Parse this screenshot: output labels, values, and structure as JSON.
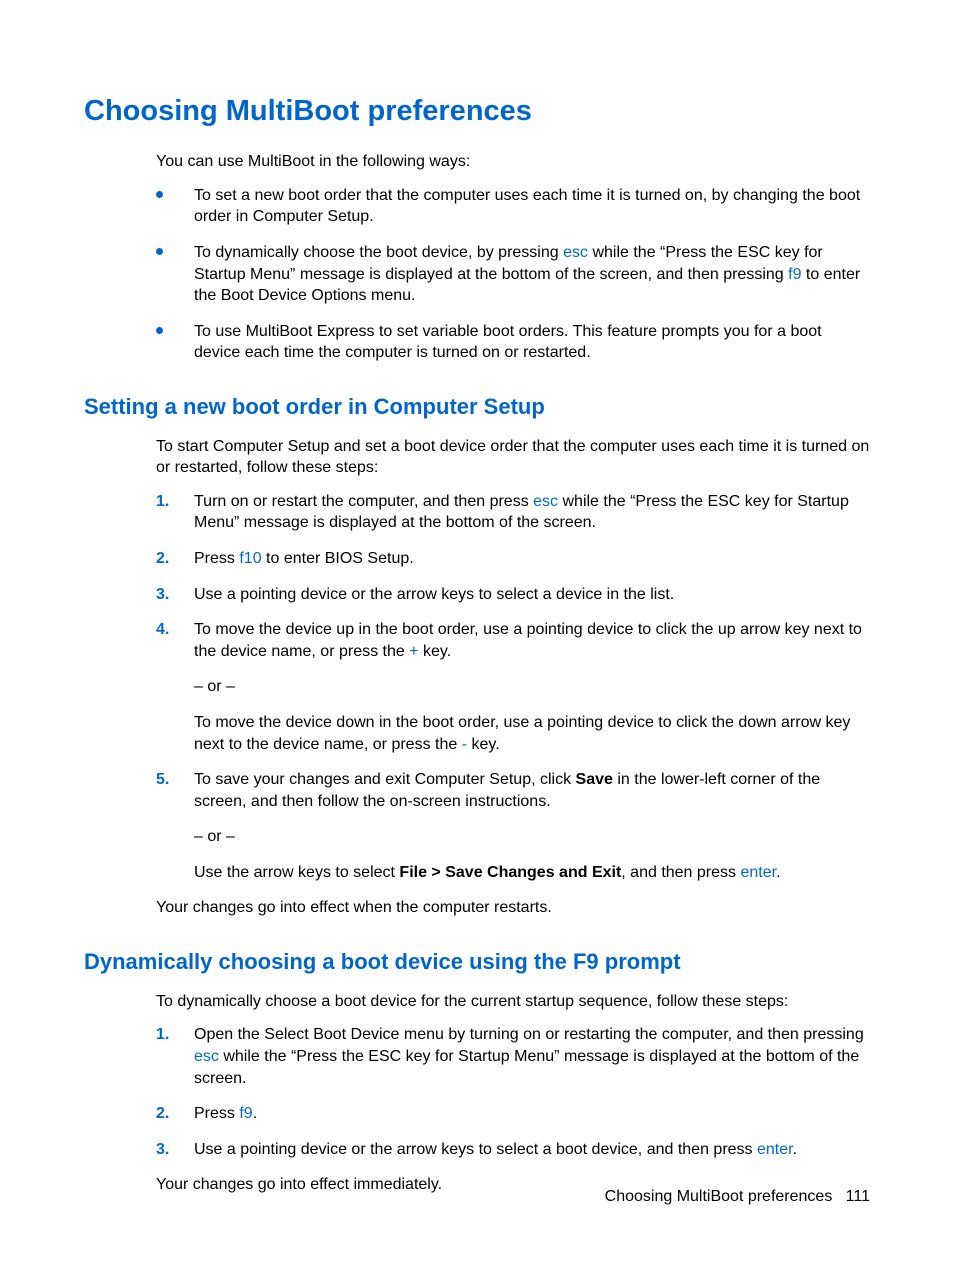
{
  "h1": "Choosing MultiBoot preferences",
  "intro1": "You can use MultiBoot in the following ways:",
  "bullets": {
    "b1": "To set a new boot order that the computer uses each time it is turned on, by changing the boot order in Computer Setup.",
    "b2a": "To dynamically choose the boot device, by pressing ",
    "b2_esc": "esc",
    "b2b": " while the “Press the ESC key for Startup Menu” message is displayed at the bottom of the screen, and then pressing ",
    "b2_f9": "f9",
    "b2c": " to enter the Boot Device Options menu.",
    "b3": "To use MultiBoot Express to set variable boot orders. This feature prompts you for a boot device each time the computer is turned on or restarted."
  },
  "h2a": "Setting a new boot order in Computer Setup",
  "p2": "To start Computer Setup and set a boot device order that the computer uses each time it is turned on or restarted, follow these steps:",
  "steps_a": {
    "s1a": "Turn on or restart the computer, and then press ",
    "s1_esc": "esc",
    "s1b": " while the “Press the ESC key for Startup Menu” message is displayed at the bottom of the screen.",
    "s2a": "Press ",
    "s2_f10": "f10",
    "s2b": " to enter BIOS Setup.",
    "s3": "Use a pointing device or the arrow keys to select a device in the list.",
    "s4a": "To move the device up in the boot order, use a pointing device to click the up arrow key next to the device name, or press the ",
    "s4_plus": "+",
    "s4b": " key.",
    "s4_or": "– or –",
    "s4c": "To move the device down in the boot order, use a pointing device to click the down arrow key next to the device name, or press the ",
    "s4_minus": "-",
    "s4d": " key.",
    "s5a": "To save your changes and exit Computer Setup, click ",
    "s5_save": "Save",
    "s5b": " in the lower-left corner of the screen, and then follow the on-screen instructions.",
    "s5_or": "– or –",
    "s5c": "Use the arrow keys to select ",
    "s5_path": "File > Save Changes and Exit",
    "s5d": ", and then press ",
    "s5_enter": "enter",
    "s5e": "."
  },
  "p3": "Your changes go into effect when the computer restarts.",
  "h2b": "Dynamically choosing a boot device using the F9 prompt",
  "p4": "To dynamically choose a boot device for the current startup sequence, follow these steps:",
  "steps_b": {
    "s1a": "Open the Select Boot Device menu by turning on or restarting the computer, and then pressing ",
    "s1_esc": "esc",
    "s1b": " while the “Press the ESC key for Startup Menu” message is displayed at the bottom of the screen.",
    "s2a": "Press ",
    "s2_f9": "f9",
    "s2b": ".",
    "s3a": "Use a pointing device or the arrow keys to select a boot device, and then press ",
    "s3_enter": "enter",
    "s3b": "."
  },
  "p5": "Your changes go into effect immediately.",
  "footer_label": "Choosing MultiBoot preferences",
  "footer_page": "111"
}
